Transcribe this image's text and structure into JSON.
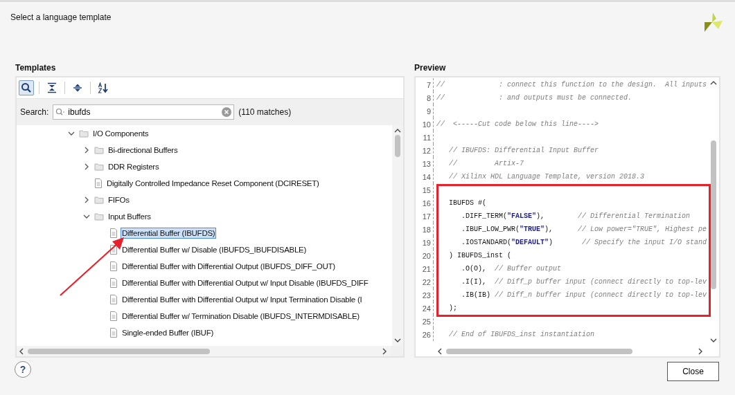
{
  "dialog": {
    "title": "Select a language template"
  },
  "templates": {
    "label": "Templates",
    "toolbar": [
      {
        "kind": "search",
        "selected": true
      },
      {
        "kind": "collapse",
        "selected": false
      },
      {
        "kind": "expand",
        "selected": false
      },
      {
        "kind": "sort",
        "selected": false
      }
    ],
    "search": {
      "label": "Search:",
      "value": "ibufds",
      "matches": "(110 matches)"
    },
    "tree": [
      {
        "label": "I/O Components",
        "kind": "folder",
        "expanded": true,
        "selected": false,
        "children": [
          {
            "label": "Bi-directional Buffers",
            "kind": "folder",
            "expanded": false,
            "selected": false
          },
          {
            "label": "DDR Registers",
            "kind": "folder",
            "expanded": false,
            "selected": false
          },
          {
            "label": "Digitally Controlled Impedance Reset Component (DCIRESET)",
            "kind": "file",
            "selected": false
          },
          {
            "label": "FIFOs",
            "kind": "folder",
            "expanded": false,
            "selected": false
          },
          {
            "label": "Input Buffers",
            "kind": "folder",
            "expanded": true,
            "selected": false,
            "children": [
              {
                "label": "Differential Buffer (IBUFDS)",
                "kind": "file",
                "selected": true
              },
              {
                "label": "Differential Buffer w/ Disable (IBUFDS_IBUFDISABLE)",
                "kind": "file",
                "selected": false
              },
              {
                "label": "Differential Buffer with Differential Output (IBUFDS_DIFF_OUT)",
                "kind": "file",
                "selected": false
              },
              {
                "label": "Differential Buffer with Differential Output w/ Input Disable (IBUFDS_DIFF",
                "kind": "file",
                "selected": false
              },
              {
                "label": "Differential Buffer with Differential Output w/ Input Termination Disable (I",
                "kind": "file",
                "selected": false
              },
              {
                "label": "Differential Buffer w/ Termination Disable (IBUFDS_INTERMDISABLE)",
                "kind": "file",
                "selected": false
              },
              {
                "label": "Single-ended Buffer (IBUF)",
                "kind": "file",
                "selected": false
              }
            ]
          }
        ]
      }
    ]
  },
  "preview": {
    "label": "Preview",
    "lines": [
      {
        "number": "7",
        "parts": [
          {
            "kind": "comment",
            "text": "//             : connect this function to the design.  All inputs"
          }
        ]
      },
      {
        "number": "8",
        "parts": [
          {
            "kind": "comment",
            "text": "//             : and outputs must be connected."
          }
        ]
      },
      {
        "number": "9"
      },
      {
        "number": "10",
        "parts": [
          {
            "kind": "comment",
            "text": "//  <-----Cut code below this line---->"
          }
        ]
      },
      {
        "number": "11"
      },
      {
        "number": "12",
        "parts": [
          {
            "kind": "comment",
            "text": "   // IBUFDS: Differential Input Buffer"
          }
        ]
      },
      {
        "number": "13",
        "parts": [
          {
            "kind": "comment",
            "text": "   //         Artix-7"
          }
        ]
      },
      {
        "number": "14",
        "parts": [
          {
            "kind": "comment",
            "text": "   // Xilinx HDL Language Template, version 2018.3"
          }
        ]
      },
      {
        "number": "15"
      },
      {
        "number": "16",
        "parts": [
          {
            "kind": "code",
            "text": "   IBUFDS #("
          }
        ]
      },
      {
        "number": "17",
        "parts": [
          {
            "kind": "code",
            "text": "      .DIFF_TERM("
          },
          {
            "kind": "string",
            "text": "\"FALSE\""
          },
          {
            "kind": "code",
            "text": "),        "
          },
          {
            "kind": "comment",
            "text": "// Differential Termination"
          }
        ]
      },
      {
        "number": "18",
        "parts": [
          {
            "kind": "code",
            "text": "      .IBUF_LOW_PWR("
          },
          {
            "kind": "string",
            "text": "\"TRUE\""
          },
          {
            "kind": "code",
            "text": "),      "
          },
          {
            "kind": "comment",
            "text": "// Low power=\"TRUE\", Highest pe"
          }
        ]
      },
      {
        "number": "19",
        "parts": [
          {
            "kind": "code",
            "text": "      .IOSTANDARD("
          },
          {
            "kind": "string",
            "text": "\"DEFAULT\""
          },
          {
            "kind": "code",
            "text": ")       "
          },
          {
            "kind": "comment",
            "text": "// Specify the input I/O stand"
          }
        ]
      },
      {
        "number": "20",
        "parts": [
          {
            "kind": "code",
            "text": "   ) IBUFDS_inst ("
          }
        ]
      },
      {
        "number": "21",
        "parts": [
          {
            "kind": "code",
            "text": "      .O(O),  "
          },
          {
            "kind": "comment",
            "text": "// Buffer output"
          }
        ]
      },
      {
        "number": "22",
        "parts": [
          {
            "kind": "code",
            "text": "      .I(I),  "
          },
          {
            "kind": "comment",
            "text": "// Diff_p buffer input (connect directly to top-lev"
          }
        ]
      },
      {
        "number": "23",
        "parts": [
          {
            "kind": "code",
            "text": "      .IB(IB) "
          },
          {
            "kind": "comment",
            "text": "// Diff_n buffer input (connect directly to top-lev"
          }
        ]
      },
      {
        "number": "24",
        "parts": [
          {
            "kind": "code",
            "text": "   );"
          }
        ]
      },
      {
        "number": "25"
      },
      {
        "number": "26",
        "parts": [
          {
            "kind": "comment",
            "text": "   // End of IBUFDS_inst instantiation"
          }
        ]
      }
    ]
  },
  "footer": {
    "help": "?",
    "close": "Close"
  }
}
